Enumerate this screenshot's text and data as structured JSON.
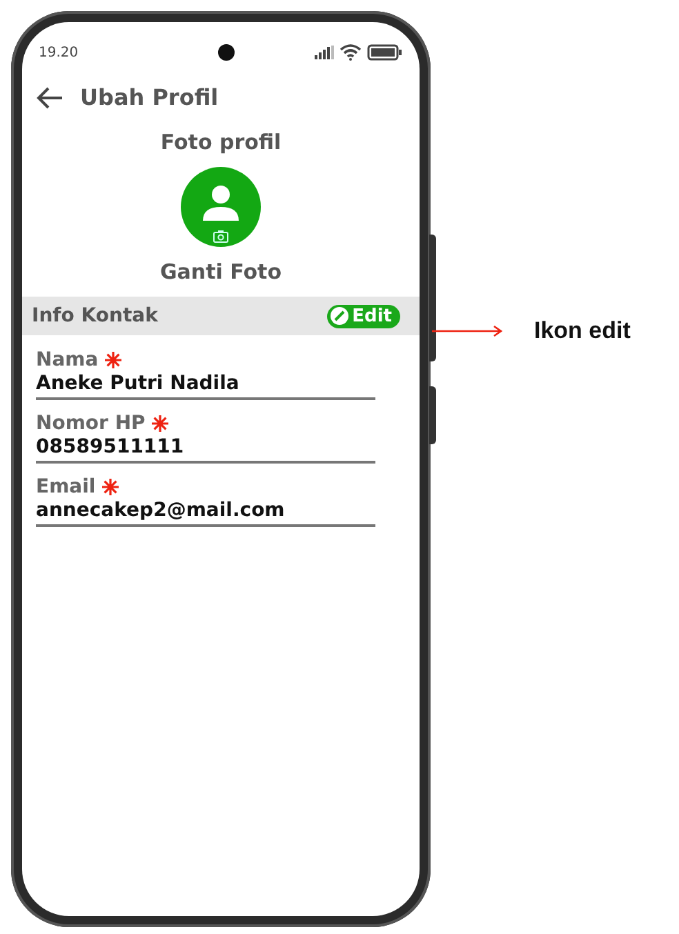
{
  "status_bar": {
    "time": "19.20"
  },
  "header": {
    "title": "Ubah Profil"
  },
  "profile_photo": {
    "heading": "Foto profil",
    "action": "Ganti Foto"
  },
  "section": {
    "title": "Info Kontak",
    "edit_button": "Edit"
  },
  "fields": [
    {
      "label": "Nama",
      "required": true,
      "value": "Aneke Putri Nadila"
    },
    {
      "label": "Nomor HP",
      "required": true,
      "value": "08589511111"
    },
    {
      "label": "Email",
      "required": true,
      "value": "annecakep2@mail.com"
    }
  ],
  "annotation": {
    "label": "Ikon edit"
  }
}
